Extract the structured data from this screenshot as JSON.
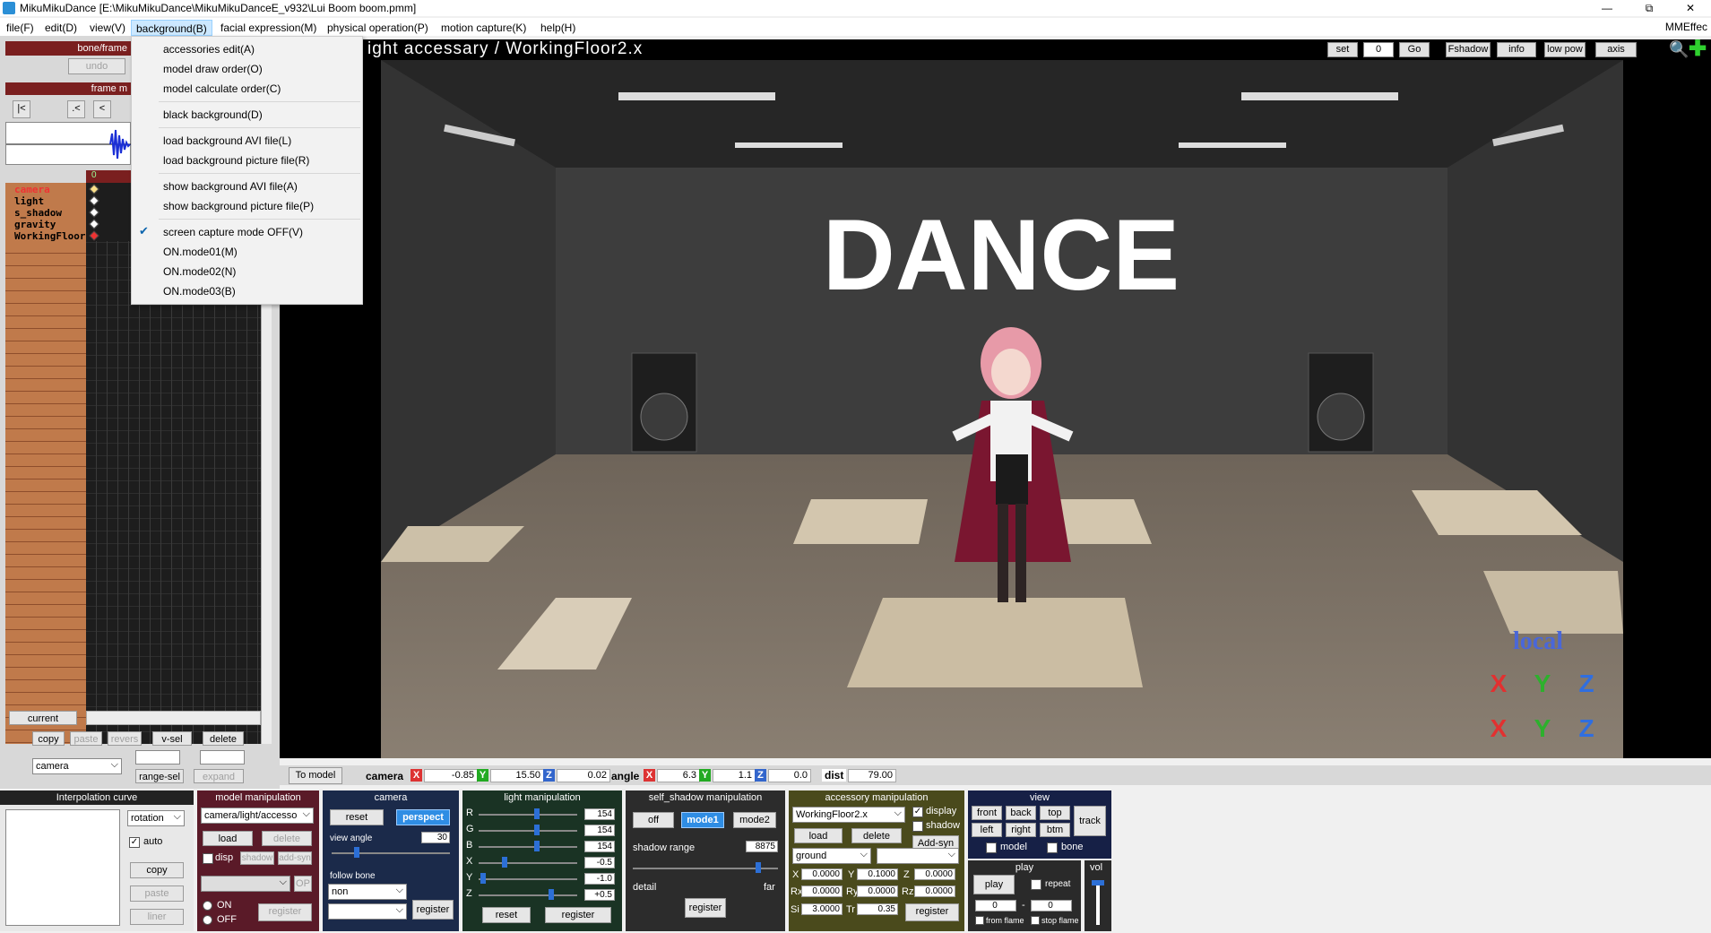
{
  "window": {
    "title": "MikuMikuDance [E:\\MikuMikuDance\\MikuMikuDanceE_v932\\Lui Boom boom.pmm]",
    "minimize": "—",
    "restore": "⧉",
    "close": "✕"
  },
  "menubar": {
    "items": [
      "file(F)",
      "edit(D)",
      "view(V)",
      "background(B)",
      "facial expression(M)",
      "physical operation(P)",
      "motion capture(K)",
      "help(H)"
    ],
    "right": "MMEffec"
  },
  "background_menu": {
    "items": [
      "accessories edit(A)",
      "model draw order(O)",
      "model calculate order(C)",
      "black background(D)",
      "load background AVI file(L)",
      "load background picture file(R)",
      "show background AVI file(A)",
      "show background picture file(P)",
      "screen capture mode OFF(V)",
      "ON.mode01(M)",
      "ON.mode02(N)",
      "ON.mode03(B)"
    ],
    "checked_item": "screen capture mode OFF(V)"
  },
  "left_panel": {
    "header": "bone/frame",
    "undo": "undo",
    "frame_header": "frame m",
    "nav": [
      "|<",
      ".<",
      "<"
    ],
    "frame_zero": "0",
    "tracks": [
      "camera",
      "light",
      "s_shadow",
      "gravity",
      "WorkingFloor"
    ],
    "current": "current",
    "buttons": {
      "copy": "copy",
      "paste": "paste",
      "revers": "revers",
      "vsel": "v-sel",
      "delete": "delete",
      "range_sel": "range-sel",
      "expand": "expand"
    },
    "mode_select": "camera"
  },
  "viewport": {
    "title": "ight accessary / WorkingFloor2.x",
    "top_buttons": {
      "set": "set",
      "frame": "0",
      "go": "Go",
      "fshadow": "Fshadow",
      "info": "info",
      "lowpow": "low pow",
      "axis": "axis"
    },
    "stage_text": "DANCE",
    "local_label": "local",
    "axis_icons": [
      "X",
      "Y",
      "Z",
      "X",
      "Y",
      "Z"
    ]
  },
  "camera_bar": {
    "to_model": "To model",
    "camera_label": "camera",
    "x": "-0.85",
    "y": "15.50",
    "z": "0.02",
    "angle_label": "angle",
    "ax": "6.3",
    "ay": "1.1",
    "az": "0.0",
    "dist_label": "dist",
    "dist": "79.00",
    "axis_tags": [
      "X",
      "Y",
      "Z"
    ]
  },
  "interpolation": {
    "header": "Interpolation curve",
    "select": "rotation",
    "auto": "auto",
    "copy": "copy",
    "paste": "paste",
    "liner": "liner"
  },
  "model_manip": {
    "header": "model manipulation",
    "select": "camera/light/accesso",
    "load": "load",
    "delete": "delete",
    "disp": "disp",
    "shadow": "shadow",
    "addsyn": "add-syn",
    "op": "OP",
    "on": "ON",
    "off": "OFF",
    "register": "register"
  },
  "camera_panel": {
    "header": "camera",
    "reset": "reset",
    "perspect": "perspect",
    "view_angle": "view angle",
    "view_angle_value": "30",
    "view_angle_level": 0.2,
    "follow_bone": "follow bone",
    "follow_select": "non",
    "register": "register"
  },
  "light_panel": {
    "header": "light manipulation",
    "channels": [
      {
        "label": "R",
        "value": "154",
        "level": 0.6
      },
      {
        "label": "G",
        "value": "154",
        "level": 0.6
      },
      {
        "label": "B",
        "value": "154",
        "level": 0.6
      },
      {
        "label": "X",
        "value": "-0.5",
        "level": 0.25
      },
      {
        "label": "Y",
        "value": "-1.0",
        "level": 0.02
      },
      {
        "label": "Z",
        "value": "+0.5",
        "level": 0.75
      }
    ],
    "reset": "reset",
    "register": "register"
  },
  "shadow_panel": {
    "header": "self_shadow manipulation",
    "off": "off",
    "mode1": "mode1",
    "mode2": "mode2",
    "range_label": "shadow range",
    "range_value": "8875",
    "range_level": 0.88,
    "detail": "detail",
    "far": "far",
    "register": "register"
  },
  "accessory_panel": {
    "header": "accessory manipulation",
    "select": "WorkingFloor2.x",
    "display": "display",
    "shadow": "shadow",
    "load": "load",
    "delete": "delete",
    "addsyn": "Add-syn",
    "ground": "ground",
    "x": "0.0000",
    "y": "0.1000",
    "z": "0.0000",
    "rx": "0.0000",
    "ry": "0.0000",
    "rz": "0.0000",
    "si": "3.0000",
    "tr": "0.35",
    "labels": {
      "x": "X",
      "y": "Y",
      "z": "Z",
      "rx": "Rx",
      "ry": "Ry",
      "rz": "Rz",
      "si": "Si",
      "tr": "Tr"
    },
    "register": "register"
  },
  "view_panel": {
    "header": "view",
    "front": "front",
    "back": "back",
    "top": "top",
    "track": "track",
    "left": "left",
    "right": "right",
    "btm": "btm",
    "model": "model",
    "bone": "bone"
  },
  "play_panel": {
    "header": "play",
    "play": "play",
    "repeat": "repeat",
    "from": "0",
    "to": "0",
    "dash": "-",
    "from_flame": "from flame",
    "stop_flame": "stop flame",
    "vol": "vol"
  }
}
